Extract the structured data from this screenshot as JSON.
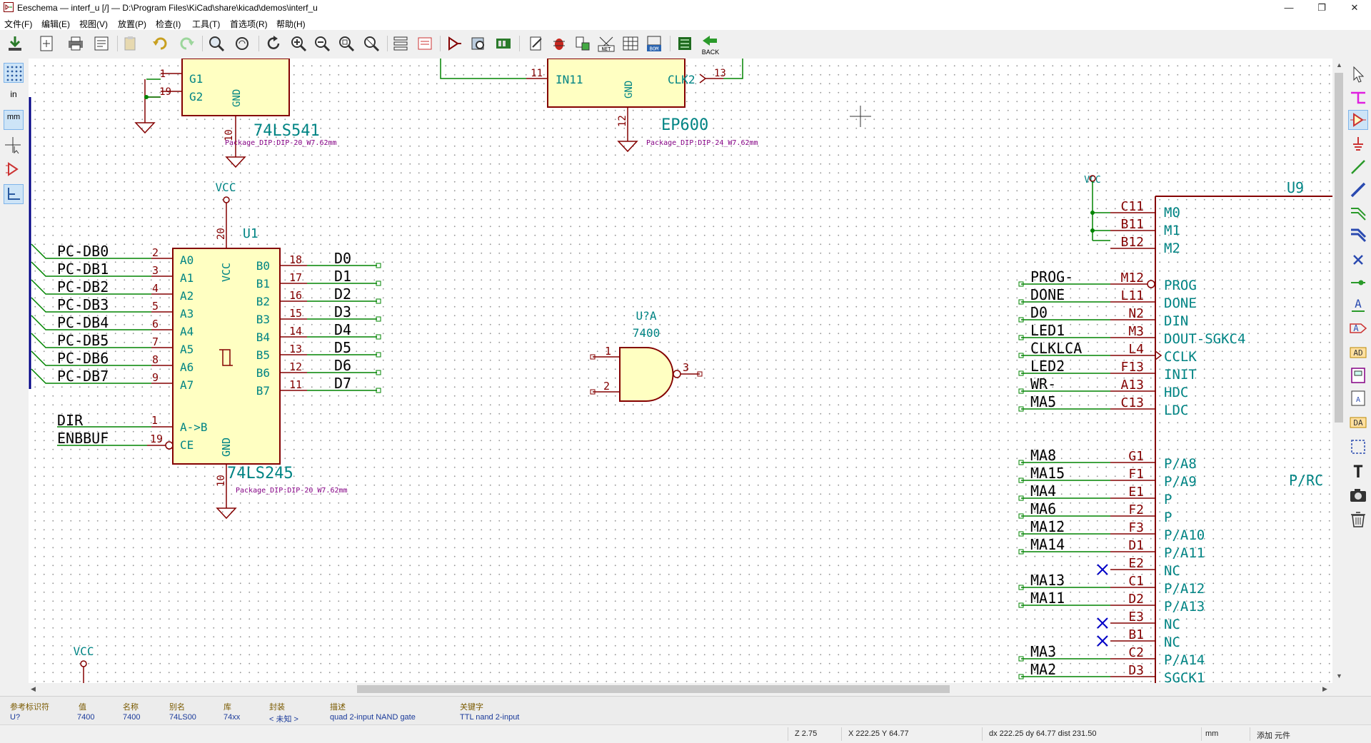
{
  "window": {
    "title": "Eeschema — interf_u [/] — D:\\Program Files\\KiCad\\share\\kicad\\demos\\interf_u",
    "minimize": "—",
    "restore": "❐",
    "close": "✕"
  },
  "menubar": [
    "文件(F)",
    "编辑(E)",
    "视图(V)",
    "放置(P)",
    "检查(I)",
    "工具(T)",
    "首选项(R)",
    "帮助(H)"
  ],
  "toolbar": {
    "back_label": "BACK",
    "net_label": "NET",
    "bom_label": "BOM"
  },
  "left_toolbar": {
    "units_in": "in",
    "units_mm": "mm"
  },
  "colors": {
    "wire": "#008400",
    "pin": "#840000",
    "body_fill": "#ffffc2",
    "ref_text": "#008484",
    "footprint_text": "#840084",
    "bus": "#000084",
    "noconnect": "#0000c8"
  },
  "schematic": {
    "u_top_left": {
      "pins_left": [
        {
          "num": "1",
          "name": "G1"
        },
        {
          "num": "19",
          "name": "G2"
        }
      ],
      "gnd_label": "GND",
      "gnd_pin": "10",
      "value": "74LS541",
      "footprint": "Package_DIP:DIP-20_W7.62mm"
    },
    "u_top_mid": {
      "pin_in_num": "11",
      "pin_in_name": "IN11",
      "gnd_label": "GND",
      "gnd_pin": "12",
      "pin_clk_name": "CLK2",
      "pin_clk_num": "13",
      "value": "EP600",
      "footprint": "Package_DIP:DIP-24_W7.62mm"
    },
    "u1": {
      "ref": "U1",
      "vcc_label": "VCC",
      "vcc_pin_num": "20",
      "vcc_pin_name": "VCC",
      "left_pins": [
        {
          "net": "PC-DB0",
          "num": "2",
          "name": "A0"
        },
        {
          "net": "PC-DB1",
          "num": "3",
          "name": "A1"
        },
        {
          "net": "PC-DB2",
          "num": "4",
          "name": "A2"
        },
        {
          "net": "PC-DB3",
          "num": "5",
          "name": "A3"
        },
        {
          "net": "PC-DB4",
          "num": "6",
          "name": "A4"
        },
        {
          "net": "PC-DB5",
          "num": "7",
          "name": "A5"
        },
        {
          "net": "PC-DB6",
          "num": "8",
          "name": "A6"
        },
        {
          "net": "PC-DB7",
          "num": "9",
          "name": "A7"
        }
      ],
      "right_pins": [
        {
          "name": "B0",
          "num": "18",
          "net": "D0"
        },
        {
          "name": "B1",
          "num": "17",
          "net": "D1"
        },
        {
          "name": "B2",
          "num": "16",
          "net": "D2"
        },
        {
          "name": "B3",
          "num": "15",
          "net": "D3"
        },
        {
          "name": "B4",
          "num": "14",
          "net": "D4"
        },
        {
          "name": "B5",
          "num": "13",
          "net": "D5"
        },
        {
          "name": "B6",
          "num": "12",
          "net": "D6"
        },
        {
          "name": "B7",
          "num": "11",
          "net": "D7"
        }
      ],
      "dir_net": "DIR",
      "dir_num": "1",
      "dir_name": "A->B",
      "enb_net": "ENBBUF",
      "enb_num": "19",
      "enb_name": "CE",
      "gnd_label": "GND",
      "gnd_pin": "10",
      "value": "74LS245",
      "footprint": "Package_DIP:DIP-20_W7.62mm"
    },
    "nand": {
      "ref": "U?A",
      "value": "7400",
      "pin1": "1",
      "pin2": "2",
      "pin3": "3"
    },
    "vcc_bottom_label": "VCC",
    "u9": {
      "ref": "U9",
      "vcc_label": "VCC",
      "mode_pins": [
        {
          "num": "C11",
          "name": "M0"
        },
        {
          "num": "B11",
          "name": "M1"
        },
        {
          "num": "B12",
          "name": "M2"
        }
      ],
      "pins": [
        {
          "net": "PROG-",
          "num": "M12",
          "name": "PROG"
        },
        {
          "net": "DONE",
          "num": "L11",
          "name": "DONE"
        },
        {
          "net": "D0",
          "num": "N2",
          "name": "DIN"
        },
        {
          "net": "LED1",
          "num": "M3",
          "name": "DOUT-SGKC4"
        },
        {
          "net": "CLKLCA",
          "num": "L4",
          "name": "CCLK"
        },
        {
          "net": "LED2",
          "num": "F13",
          "name": "INIT"
        },
        {
          "net": "WR-",
          "num": "A13",
          "name": "HDC"
        },
        {
          "net": "MA5",
          "num": "C13",
          "name": "LDC"
        }
      ],
      "addr_pins": [
        {
          "net": "MA8",
          "num": "G1",
          "name": "P/A8"
        },
        {
          "net": "MA15",
          "num": "F1",
          "name": "P/A9"
        },
        {
          "net": "MA4",
          "num": "E1",
          "name": "P"
        },
        {
          "net": "MA6",
          "num": "F2",
          "name": "P"
        },
        {
          "net": "MA12",
          "num": "F3",
          "name": "P/A10"
        },
        {
          "net": "MA14",
          "num": "D1",
          "name": "P/A11"
        },
        {
          "net": "",
          "num": "E2",
          "name": "NC"
        },
        {
          "net": "MA13",
          "num": "C1",
          "name": "P/A12"
        },
        {
          "net": "MA11",
          "num": "D2",
          "name": "P/A13"
        },
        {
          "net": "",
          "num": "E3",
          "name": "NC"
        },
        {
          "net": "",
          "num": "B1",
          "name": "NC"
        },
        {
          "net": "MA3",
          "num": "C2",
          "name": "P/A14"
        },
        {
          "net": "MA2",
          "num": "D3",
          "name": "SGCK1"
        }
      ],
      "right_label": "P/RC"
    }
  },
  "message_panel": {
    "fields": [
      {
        "label": "参考标识符",
        "value": "U?"
      },
      {
        "label": "值",
        "value": "7400"
      },
      {
        "label": "名称",
        "value": "7400"
      },
      {
        "label": "别名",
        "value": "74LS00"
      },
      {
        "label": "库",
        "value": "74xx"
      },
      {
        "label": "封装",
        "value": "< 未知 >"
      },
      {
        "label": "描述",
        "value": "quad 2-input NAND gate"
      },
      {
        "label": "关键字",
        "value": "TTL nand 2-input"
      }
    ]
  },
  "statusbar": {
    "zoom": "Z 2.75",
    "xy": "X 222.25  Y 64.77",
    "dxy": "dx 222.25  dy 64.77  dist 231.50",
    "units": "mm",
    "mode": "添加 元件"
  }
}
